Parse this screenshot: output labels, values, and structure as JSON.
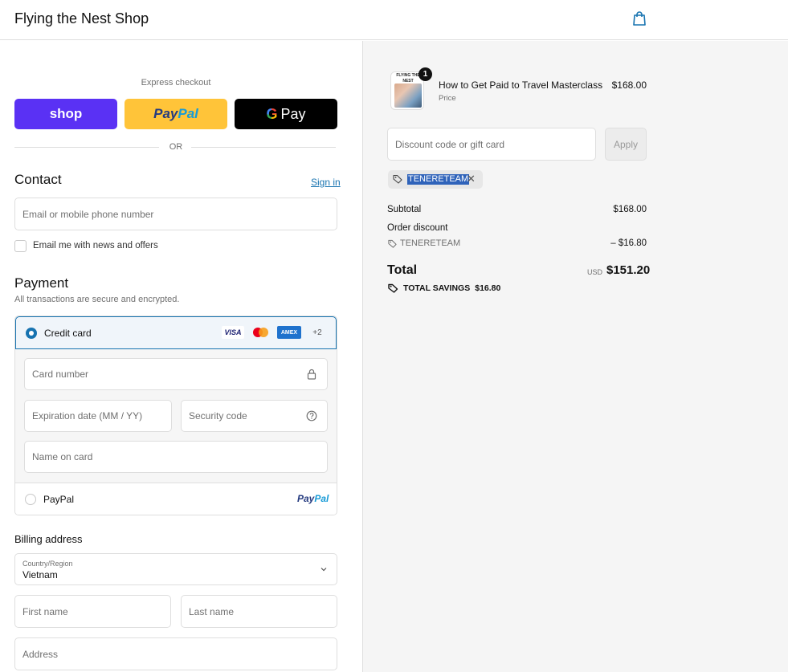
{
  "header": {
    "shop_name": "Flying the Nest Shop",
    "cart_icon": "shopping-bag-icon"
  },
  "express": {
    "label": "Express checkout",
    "shop_label": "shop",
    "paypal_label_1": "Pay",
    "paypal_label_2": "Pal",
    "gpay_g": "G",
    "gpay_label": "Pay",
    "or_label": "OR"
  },
  "contact": {
    "title": "Contact",
    "signin_label": "Sign in",
    "email_placeholder": "Email or mobile phone number",
    "news_label": "Email me with news and offers"
  },
  "payment": {
    "title": "Payment",
    "subtitle": "All transactions are secure and encrypted.",
    "credit_card_label": "Credit card",
    "card_brands": [
      "VISA",
      "",
      "AMEX",
      "+2"
    ],
    "card_number_placeholder": "Card number",
    "expiration_placeholder": "Expiration date (MM / YY)",
    "security_placeholder": "Security code",
    "name_placeholder": "Name on card",
    "paypal_option_label": "PayPal",
    "paypal_logo_1": "Pay",
    "paypal_logo_2": "Pal"
  },
  "billing": {
    "title": "Billing address",
    "country_label": "Country/Region",
    "country_value": "Vietnam",
    "first_name_placeholder": "First name",
    "last_name_placeholder": "Last name",
    "address_placeholder": "Address"
  },
  "summary": {
    "item": {
      "name": "How to Get Paid to Travel Masterclass",
      "subtitle": "Price",
      "price": "$168.00",
      "quantity": "1",
      "thumb_text": "FLYING THE NEST"
    },
    "discount_placeholder": "Discount code or gift card",
    "apply_label": "Apply",
    "applied_code": "TENERETEAM",
    "remove_symbol": "✕",
    "subtotal_label": "Subtotal",
    "subtotal_value": "$168.00",
    "order_discount_label": "Order discount",
    "discount_code": "TENERETEAM",
    "discount_value": "– $16.80",
    "total_label": "Total",
    "currency": "USD",
    "total_value": "$151.20",
    "savings_label": "TOTAL SAVINGS",
    "savings_value": "$16.80"
  },
  "colors": {
    "accent": "#1773b0",
    "shop_pay": "#5a31f4",
    "paypal": "#ffc439",
    "panel": "#f5f5f5"
  }
}
